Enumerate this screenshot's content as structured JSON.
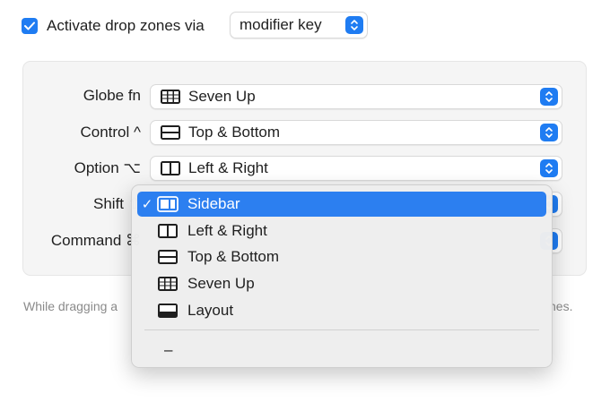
{
  "header": {
    "checkbox_checked": true,
    "label": "Activate drop zones via",
    "mode_value": "modifier key"
  },
  "modifiers": [
    {
      "label": "Globe fn",
      "value": "Seven Up",
      "icon": "seven-up-layout-icon"
    },
    {
      "label": "Control ^",
      "value": "Top & Bottom",
      "icon": "top-bottom-layout-icon"
    },
    {
      "label": "Option ⌥",
      "value": "Left & Right",
      "icon": "left-right-layout-icon"
    },
    {
      "label": "Shift ⇧",
      "value": "",
      "icon": ""
    },
    {
      "label": "Command ⌘",
      "value": "",
      "icon": ""
    }
  ],
  "hint": {
    "start": "While dragging a",
    "end": "nes."
  },
  "menu": {
    "items": [
      {
        "label": "Sidebar",
        "checked": true,
        "icon": "sidebar-layout-icon"
      },
      {
        "label": "Left & Right",
        "checked": false,
        "icon": "left-right-layout-icon"
      },
      {
        "label": "Top & Bottom",
        "checked": false,
        "icon": "top-bottom-layout-icon"
      },
      {
        "label": "Seven Up",
        "checked": false,
        "icon": "seven-up-layout-icon"
      },
      {
        "label": "Layout",
        "checked": false,
        "icon": "layout-icon"
      }
    ],
    "none_label": "–",
    "check_glyph": "✓"
  },
  "colors": {
    "accent": "#2c7ff0",
    "panel": "#f5f5f5",
    "hint_text": "#8a8a8a"
  }
}
